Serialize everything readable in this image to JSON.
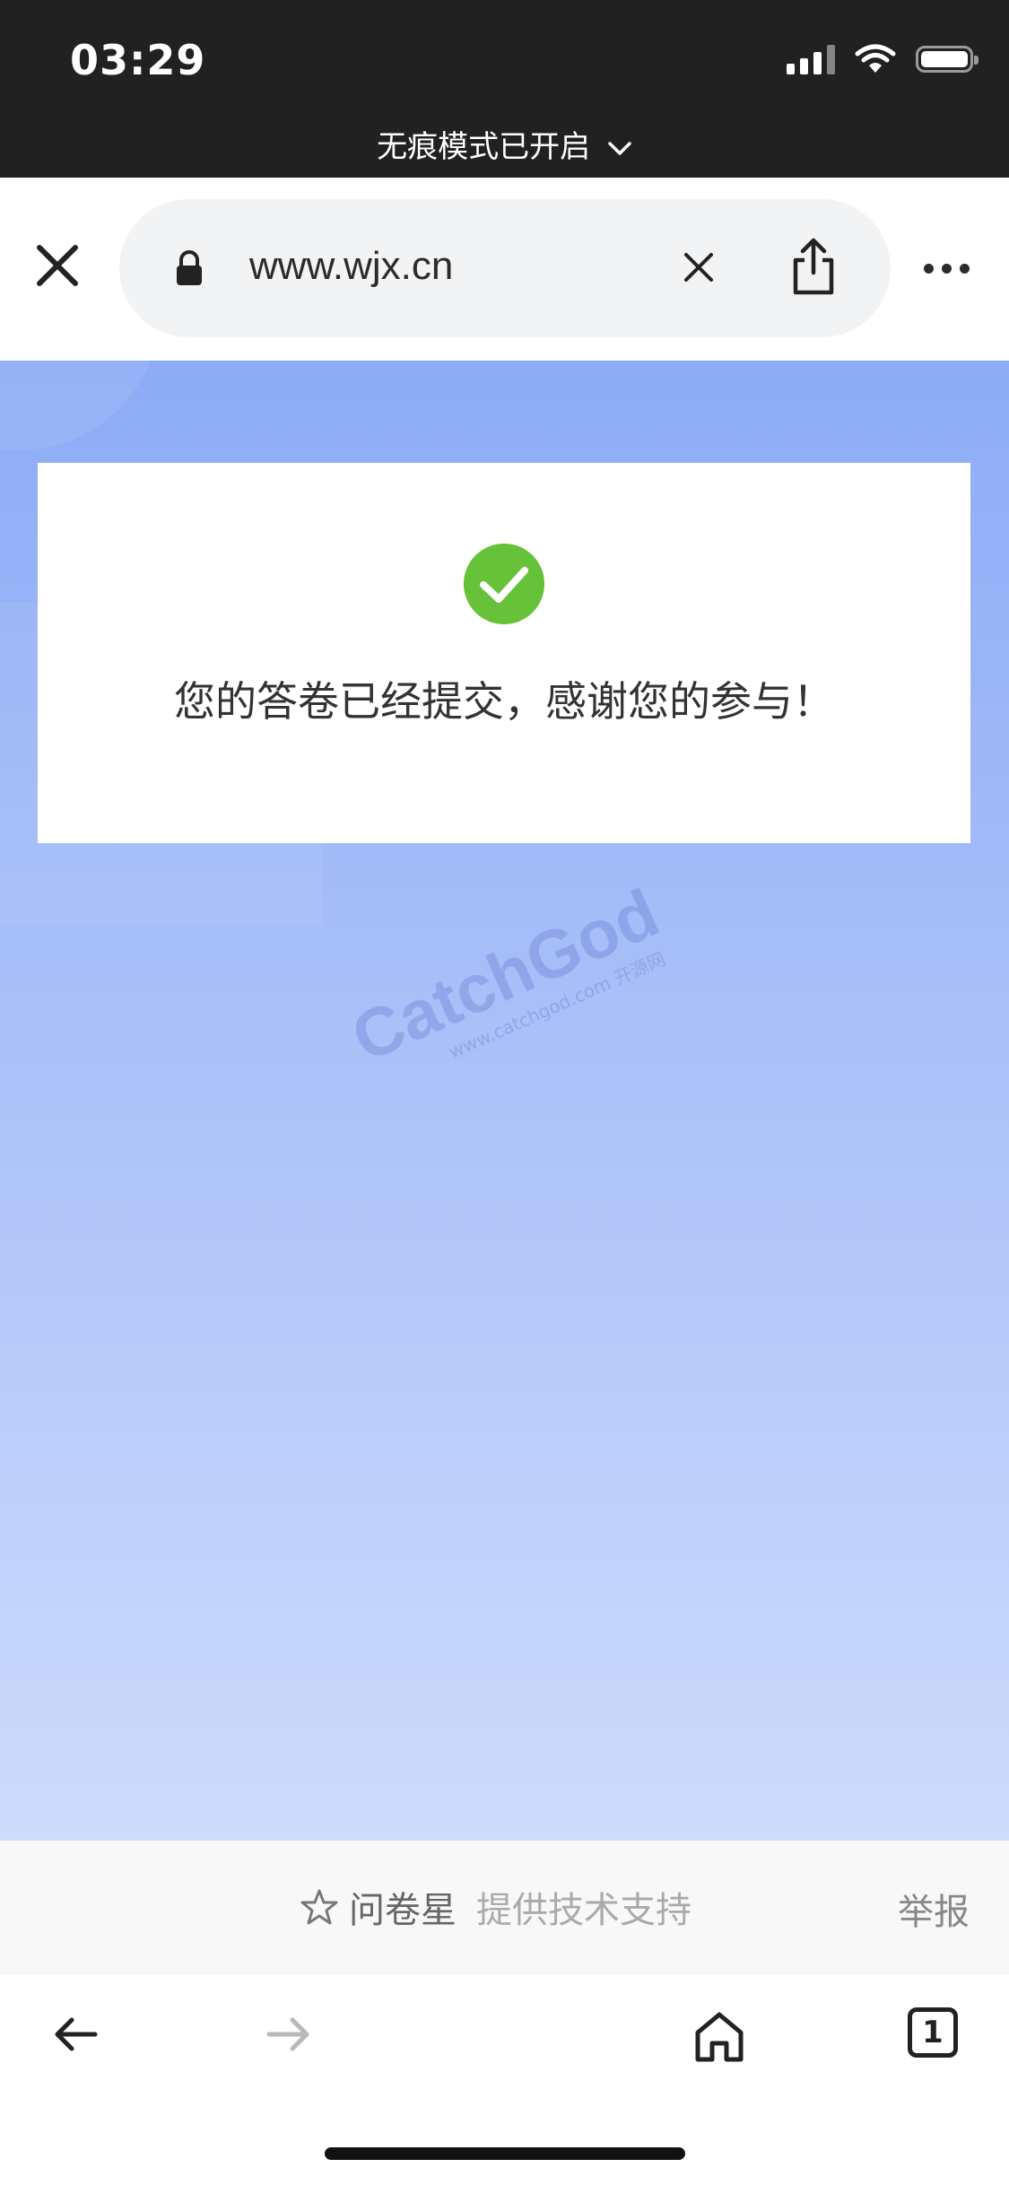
{
  "status_bar": {
    "time": "03:29"
  },
  "browser": {
    "incognito_label": "无痕模式已开启",
    "url": "www.wjx.cn",
    "tab_count": "1"
  },
  "page": {
    "message": "您的答卷已经提交，感谢您的参与！",
    "watermark": {
      "main": "CatchGod",
      "sub": "www.catchgod.com 开源网"
    }
  },
  "footer": {
    "brand": "问卷星",
    "support": "提供技术支持",
    "report": "举报"
  },
  "colors": {
    "success": "#67c23a",
    "background_top": "#8dacf6",
    "background_bottom": "#cedbfb"
  }
}
